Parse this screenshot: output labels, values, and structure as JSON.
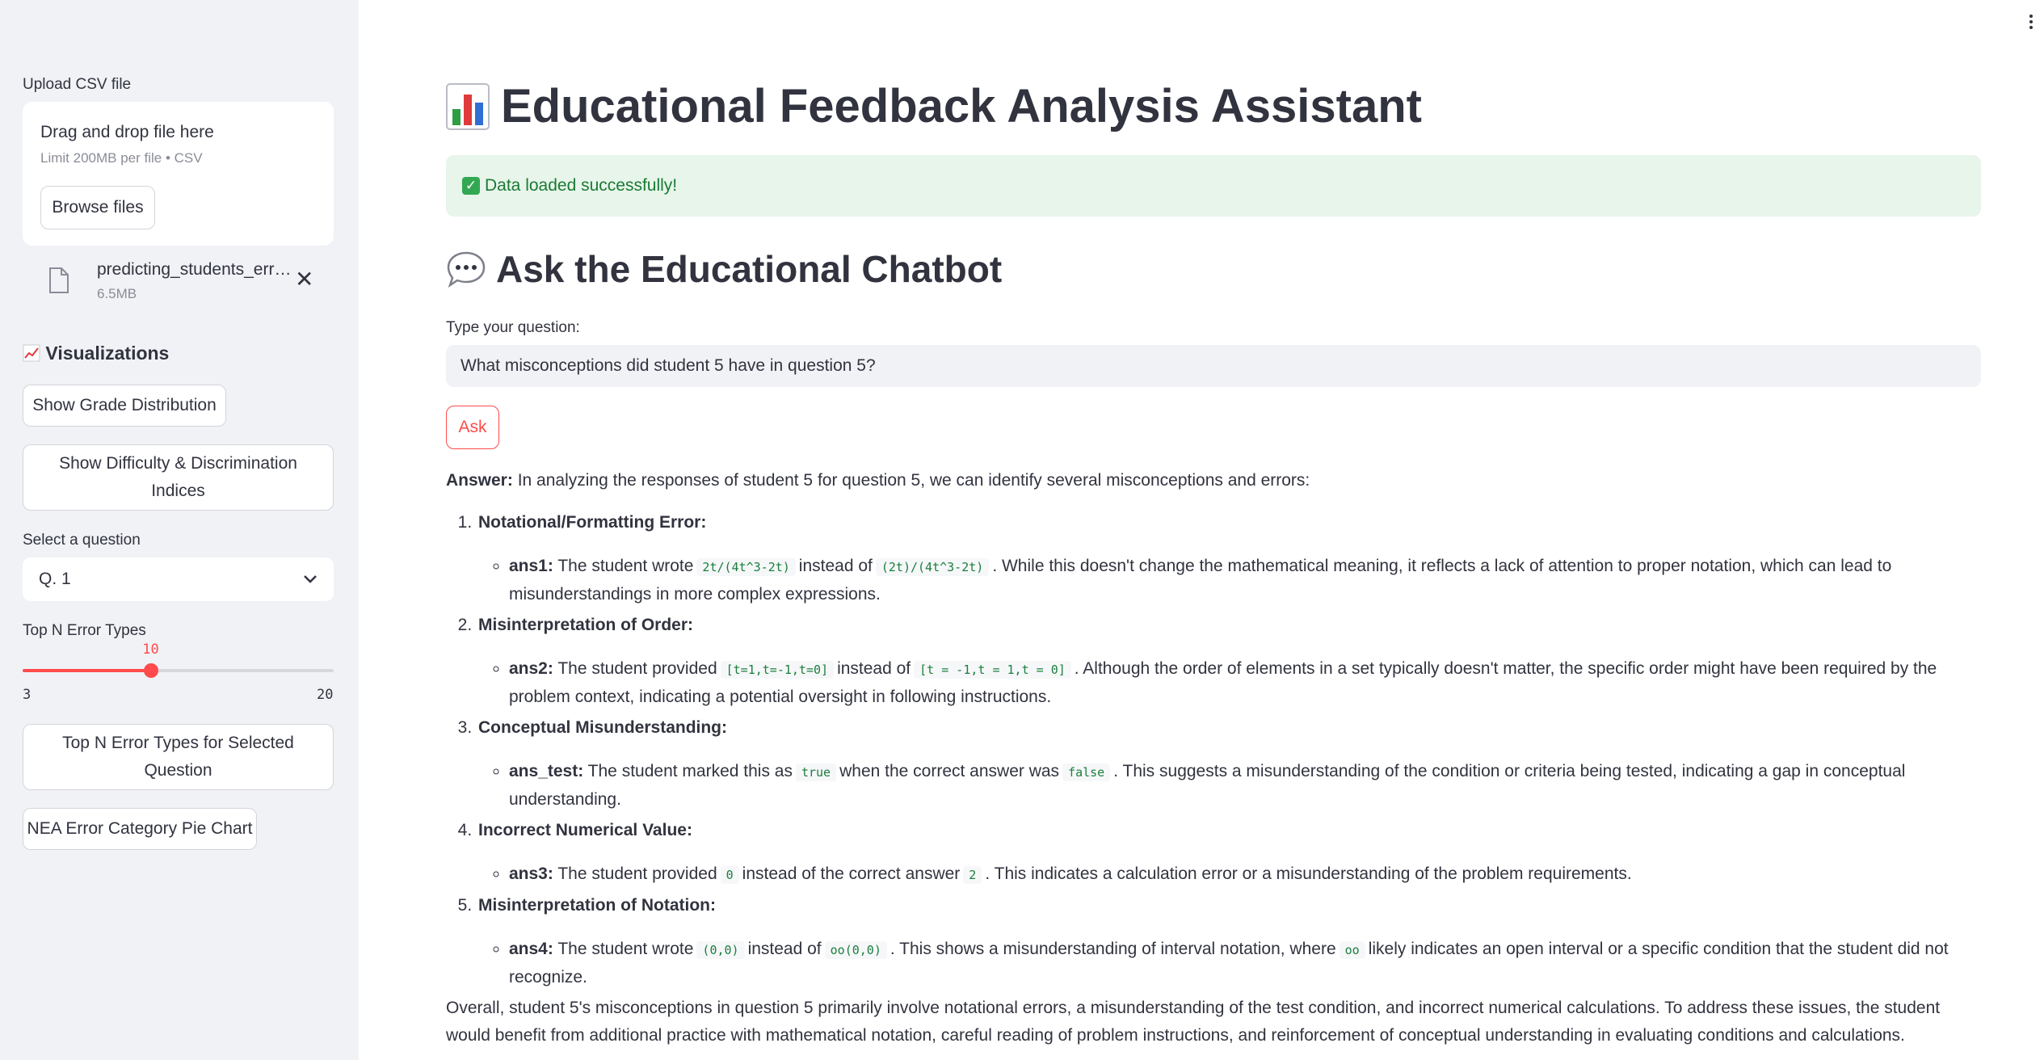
{
  "sidebar": {
    "upload_label": "Upload CSV file",
    "drag_text": "Drag and drop file here",
    "limit_text": "Limit 200MB per file • CSV",
    "browse_label": "Browse files",
    "file_name": "predicting_students_err…",
    "file_size": "6.5MB",
    "viz_heading": "Visualizations",
    "btn_grade": "Show Grade Distribution",
    "btn_difficulty": "Show Difficulty & Discrimination Indices",
    "select_label": "Select a question",
    "select_value": "Q. 1",
    "slider_label": "Top N Error Types",
    "slider_value": "10",
    "slider_min": "3",
    "slider_max": "20",
    "slider_fraction": 0.4118,
    "btn_topn": "Top N Error Types for Selected Question",
    "btn_pie": "NEA Error Category Pie Chart"
  },
  "main": {
    "title": "Educational Feedback Analysis Assistant",
    "success_text": "Data loaded successfully!",
    "chat_heading": "Ask the Educational Chatbot",
    "question_label": "Type your question:",
    "question_value": "What misconceptions did student 5 have in question 5?",
    "ask_label": "Ask",
    "answer_prefix": "Answer:",
    "answer_intro": "In analyzing the responses of student 5 for question 5, we can identify several misconceptions and errors:",
    "items": [
      {
        "heading": "Notational/Formatting Error:",
        "key": "ans1:",
        "t1": "The student wrote",
        "c1": "2t/(4t^3-2t)",
        "t2": "instead of",
        "c2": "(2t)/(4t^3-2t)",
        "t3": ". While this doesn't change the mathematical meaning, it reflects a lack of attention to proper notation, which can lead to misunderstandings in more complex expressions."
      },
      {
        "heading": "Misinterpretation of Order:",
        "key": "ans2:",
        "t1": "The student provided",
        "c1": "[t=1,t=-1,t=0]",
        "t2": "instead of",
        "c2": "[t = -1,t = 1,t = 0]",
        "t3": ". Although the order of elements in a set typically doesn't matter, the specific order might have been required by the problem context, indicating a potential oversight in following instructions."
      },
      {
        "heading": "Conceptual Misunderstanding:",
        "key": "ans_test:",
        "t1": "The student marked this as",
        "c1": "true",
        "t2": "when the correct answer was",
        "c2": "false",
        "t3": ". This suggests a misunderstanding of the condition or criteria being tested, indicating a gap in conceptual understanding."
      },
      {
        "heading": "Incorrect Numerical Value:",
        "key": "ans3:",
        "t1": "The student provided",
        "c1": "0",
        "t2": "instead of the correct answer",
        "c2": "2",
        "t3": ". This indicates a calculation error or a misunderstanding of the problem requirements."
      },
      {
        "heading": "Misinterpretation of Notation:",
        "key": "ans4:",
        "t1": "The student wrote",
        "c1": "(0,0)",
        "t2": "instead of",
        "c2": "oo(0,0)",
        "t3": ". This shows a misunderstanding of interval notation, where",
        "c3": "oo",
        "t4": "likely indicates an open interval or a specific condition that the student did not recognize."
      }
    ],
    "summary": "Overall, student 5's misconceptions in question 5 primarily involve notational errors, a misunderstanding of the test condition, and incorrect numerical calculations. To address these issues, the student would benefit from additional practice with mathematical notation, careful reading of problem instructions, and reinforcement of conceptual understanding in evaluating conditions and calculations."
  },
  "colors": {
    "accent": "#ff4b4b",
    "sidebar_bg": "#f0f2f6",
    "success_bg": "#e7f5ea",
    "success_text": "#1a7a34",
    "code_text": "#1a7f3c"
  },
  "icons": {
    "title": "bar-chart-icon",
    "success": "check-mark-icon",
    "chat": "speech-bubble-icon",
    "viz": "chart-increasing-icon",
    "file": "file-icon",
    "close": "close-icon",
    "select": "chevron-down-icon",
    "menu": "kebab-menu-icon"
  }
}
